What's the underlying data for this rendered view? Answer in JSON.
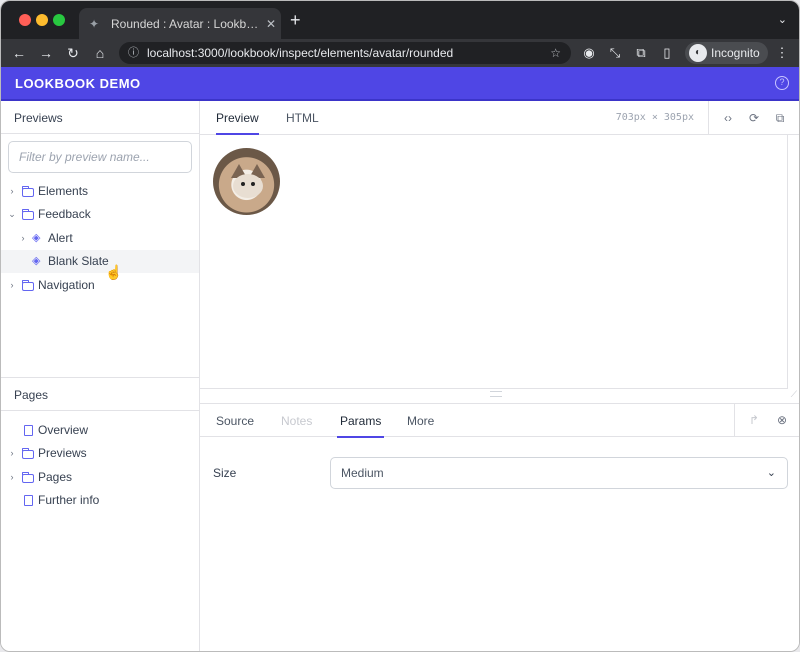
{
  "browser": {
    "tab_title": "Rounded : Avatar : Lookbook",
    "tab_favicon": "lookbook-favicon-icon",
    "url": "localhost:3000/lookbook/inspect/elements/avatar/rounded",
    "profile_label": "Incognito"
  },
  "app": {
    "brand": "LOOKBOOK DEMO",
    "accent_color": "#4f46e5"
  },
  "sidebar": {
    "previews_title": "Previews",
    "filter_placeholder": "Filter by preview name...",
    "tree": [
      {
        "label": "Elements",
        "type": "folder",
        "expanded": false
      },
      {
        "label": "Feedback",
        "type": "folder",
        "expanded": true
      },
      {
        "label": "Alert",
        "type": "component",
        "expanded": false
      },
      {
        "label": "Blank Slate",
        "type": "component",
        "active": true
      },
      {
        "label": "Navigation",
        "type": "folder",
        "expanded": false
      }
    ],
    "pages_title": "Pages",
    "pages": [
      {
        "label": "Overview",
        "type": "page"
      },
      {
        "label": "Previews",
        "type": "folder"
      },
      {
        "label": "Pages",
        "type": "folder"
      },
      {
        "label": "Further info",
        "type": "page"
      }
    ]
  },
  "main": {
    "tabs": [
      {
        "label": "Preview",
        "active": true
      },
      {
        "label": "HTML",
        "active": false
      }
    ],
    "dimensions": "703px × 305px"
  },
  "drawer": {
    "tabs": [
      {
        "label": "Source",
        "state": "normal"
      },
      {
        "label": "Notes",
        "state": "disabled"
      },
      {
        "label": "Params",
        "state": "active"
      },
      {
        "label": "More",
        "state": "normal"
      }
    ],
    "params": [
      {
        "label": "Size",
        "value": "Medium"
      }
    ]
  }
}
